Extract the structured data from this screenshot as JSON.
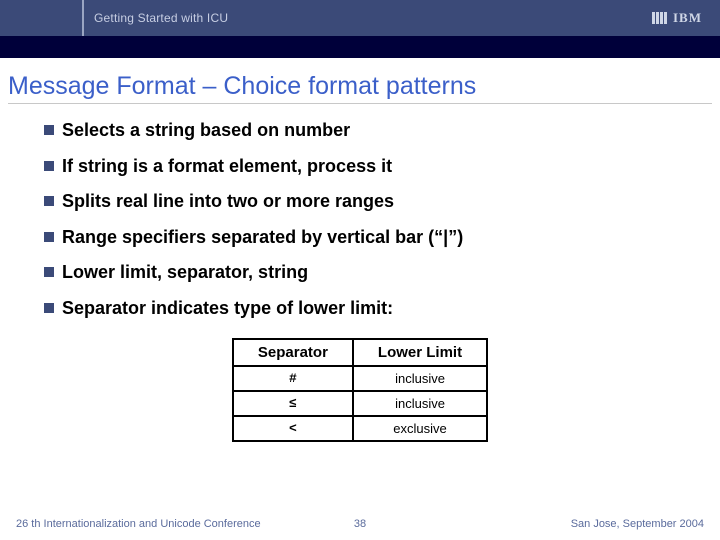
{
  "header": {
    "breadcrumb": "Getting Started with ICU",
    "logo_text": "IBM"
  },
  "title": "Message Format – Choice format patterns",
  "bullets": [
    "Selects a string based on number",
    "If string is a format element, process it",
    "Splits real line into two or more ranges",
    "Range specifiers separated by vertical bar (“|”)",
    "Lower limit, separator, string",
    "Separator indicates type of lower limit:"
  ],
  "table": {
    "headers": [
      "Separator",
      "Lower Limit"
    ],
    "rows": [
      {
        "sep": "#",
        "limit": "inclusive"
      },
      {
        "sep": "≤",
        "limit": "inclusive"
      },
      {
        "sep": "<",
        "limit": "exclusive"
      }
    ]
  },
  "footer": {
    "left": "26 th Internationalization and Unicode Conference",
    "page": "38",
    "right": "San Jose, September 2004"
  }
}
